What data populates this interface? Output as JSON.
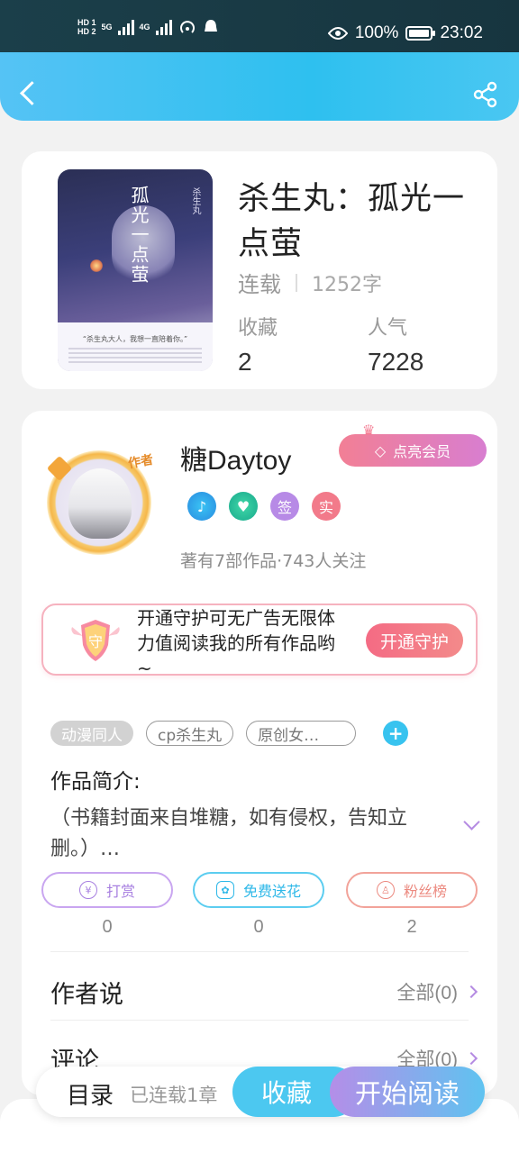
{
  "status_bar": {
    "hd1": "HD 1",
    "hd2": "HD 2",
    "net1": "5G",
    "net2": "4G",
    "battery": "100%",
    "time": "23:02"
  },
  "header": {
    "back_icon": "chevron-left-icon",
    "share_icon": "share-icon"
  },
  "book": {
    "cover_title": "孤光一点萤",
    "cover_subtitle": "杀生丸",
    "cover_quote": "“杀生丸大人，我想一直陪着你。”",
    "title": "杀生丸：孤光一点萤",
    "status": "连载",
    "words": "1252字",
    "favorites_label": "收藏",
    "favorites_value": "2",
    "popularity_label": "人气",
    "popularity_value": "7228"
  },
  "author": {
    "avatar_tag": "作者",
    "name": "糖Daytoy",
    "vip_label": "点亮会员",
    "badges": [
      "♪",
      "♥",
      "签",
      "实"
    ],
    "stats": "著有7部作品·743人关注"
  },
  "guard": {
    "icon_text": "守",
    "text": "开通守护可无广告无限体力值阅读我的所有作品哟~",
    "button": "开通守护"
  },
  "tags": [
    "动漫同人",
    "cp杀生丸",
    "原创女…"
  ],
  "intro": {
    "title": "作品简介:",
    "text": "（书籍封面来自堆糖，如有侵权，告知立删。）…"
  },
  "actions": [
    {
      "label": "打赏",
      "icon": "¥",
      "count": "0"
    },
    {
      "label": "免费送花",
      "icon": "✿",
      "count": "0"
    },
    {
      "label": "粉丝榜",
      "icon": "♙",
      "count": "2"
    }
  ],
  "author_says": {
    "title": "作者说",
    "more": "全部(0)"
  },
  "comments": {
    "title": "评论",
    "more": "全部(0)"
  },
  "bottom": {
    "toc": "目录",
    "toc_sub": "已连载1章",
    "favorite": "收藏",
    "read": "开始阅读"
  },
  "colors": {
    "accent_blue": "#2ec0ef",
    "accent_pink": "#f46b84",
    "accent_purple": "#b48ee8"
  }
}
